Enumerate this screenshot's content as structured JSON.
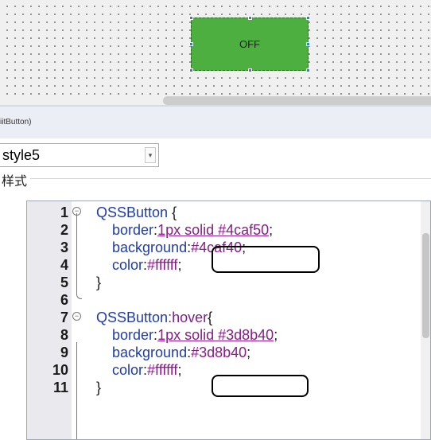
{
  "canvas": {
    "button_text": "OFF",
    "button_color": "#4caf40"
  },
  "properties": {
    "class_label": "iitButton)",
    "style_combo_value": "style5",
    "group_title": "样式"
  },
  "editor": {
    "lines": [
      {
        "num": "1",
        "fold": "open",
        "tokens": [
          {
            "t": "QSSButton",
            "c": "c-selector"
          },
          {
            "t": " {",
            "c": "c-punct"
          }
        ]
      },
      {
        "num": "2",
        "fold": "",
        "tokens": [
          {
            "t": "    border",
            "c": "c-prop"
          },
          {
            "t": ":",
            "c": "c-punct"
          },
          {
            "t": "1px solid #4caf50",
            "c": "c-value c-und"
          },
          {
            "t": ";",
            "c": "c-punct"
          }
        ]
      },
      {
        "num": "3",
        "fold": "",
        "tokens": [
          {
            "t": "    background",
            "c": "c-prop"
          },
          {
            "t": ":",
            "c": "c-punct"
          },
          {
            "t": "#4caf40",
            "c": "c-value"
          },
          {
            "t": ";",
            "c": "c-punct"
          }
        ]
      },
      {
        "num": "4",
        "fold": "",
        "tokens": [
          {
            "t": "    color",
            "c": "c-prop"
          },
          {
            "t": ":",
            "c": "c-punct"
          },
          {
            "t": "#ffffff",
            "c": "c-value"
          },
          {
            "t": ";",
            "c": "c-punct"
          }
        ]
      },
      {
        "num": "5",
        "fold": "",
        "tokens": [
          {
            "t": "}",
            "c": "c-punct"
          }
        ]
      },
      {
        "num": "6",
        "fold": "end",
        "tokens": []
      },
      {
        "num": "7",
        "fold": "open",
        "tokens": [
          {
            "t": "QSSButton",
            "c": "c-selector"
          },
          {
            "t": ":hover",
            "c": "c-pseudo"
          },
          {
            "t": "{",
            "c": "c-punct"
          }
        ]
      },
      {
        "num": "8",
        "fold": "",
        "tokens": [
          {
            "t": "    border",
            "c": "c-prop"
          },
          {
            "t": ":",
            "c": "c-punct"
          },
          {
            "t": "1px solid #3d8b40",
            "c": "c-value c-und"
          },
          {
            "t": ";",
            "c": "c-punct"
          }
        ]
      },
      {
        "num": "9",
        "fold": "",
        "tokens": [
          {
            "t": "    background",
            "c": "c-prop"
          },
          {
            "t": ":",
            "c": "c-punct"
          },
          {
            "t": "#3d8b40",
            "c": "c-value"
          },
          {
            "t": ";",
            "c": "c-punct"
          }
        ]
      },
      {
        "num": "10",
        "fold": "",
        "tokens": [
          {
            "t": "    color",
            "c": "c-prop"
          },
          {
            "t": ":",
            "c": "c-punct"
          },
          {
            "t": "#ffffff",
            "c": "c-value"
          },
          {
            "t": ";",
            "c": "c-punct"
          }
        ]
      },
      {
        "num": "11",
        "fold": "",
        "tokens": [
          {
            "t": "}",
            "c": "c-punct"
          }
        ]
      }
    ]
  },
  "icons": {
    "combo_dropdown": "chevron-down-icon"
  }
}
